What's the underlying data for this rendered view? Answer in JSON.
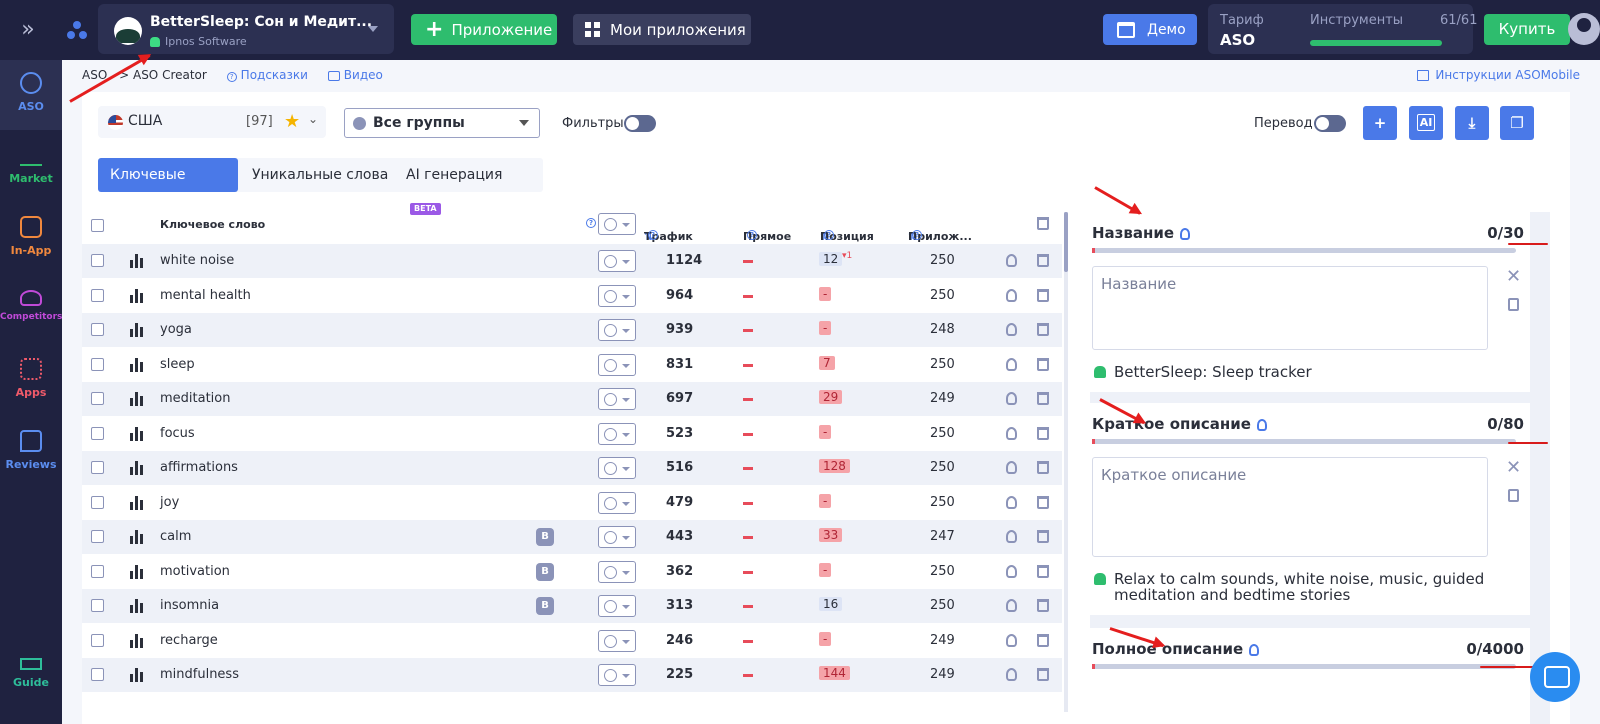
{
  "topbar": {
    "app_name": "BetterSleep: Сон и Медит...",
    "developer": "Ipnos Software",
    "add_app": "Приложение",
    "my_apps": "Мои приложения",
    "demo": "Демо",
    "tariff_label": "Тариф",
    "tariff_value": "ASO",
    "tools_label": "Инструменты",
    "tools_count": "61/61",
    "tools_usage": 1.0,
    "buy": "Купить"
  },
  "sidebar": {
    "items": [
      {
        "label": "ASO",
        "color": "#5b8def"
      },
      {
        "label": "Market",
        "color": "#2ebd6e"
      },
      {
        "label": "In-App",
        "color": "#f0883e"
      },
      {
        "label": "Competitors",
        "color": "#c04ad8"
      },
      {
        "label": "Apps",
        "color": "#ef5a6a"
      },
      {
        "label": "Reviews",
        "color": "#5b8def"
      },
      {
        "label": "Guide",
        "color": "#2ebd9a"
      }
    ]
  },
  "breadcrumb": {
    "root": "ASO",
    "current": "> ASO Creator",
    "hints": "Подсказки",
    "video": "Видео",
    "instructions": "Инструкции ASOMobile"
  },
  "controls": {
    "country": "США",
    "country_count": "[97]",
    "groups": "Все группы",
    "filters": "Фильтры",
    "translate": "Перевод",
    "ai_button": "AI"
  },
  "tabs": [
    {
      "label": "Ключевые слова"
    },
    {
      "label": "Уникальные слова"
    },
    {
      "label": "AI генерация",
      "badge": "BETA"
    }
  ],
  "table": {
    "headers": {
      "keyword": "Ключевое слово",
      "traffic": "Трафик",
      "direct": "Прямое ...",
      "position": "Позиция",
      "apps": "Прилож..."
    },
    "rows": [
      {
        "keyword": "white noise",
        "traffic": "1124",
        "position": "12",
        "pos_style": "blue",
        "change": "▾1",
        "apps": "250",
        "badge": ""
      },
      {
        "keyword": "mental health",
        "traffic": "964",
        "position": "-",
        "pos_style": "red",
        "change": "",
        "apps": "250",
        "badge": ""
      },
      {
        "keyword": "yoga",
        "traffic": "939",
        "position": "-",
        "pos_style": "red",
        "change": "",
        "apps": "248",
        "badge": ""
      },
      {
        "keyword": "sleep",
        "traffic": "831",
        "position": "7",
        "pos_style": "red",
        "change": "",
        "apps": "250",
        "badge": ""
      },
      {
        "keyword": "meditation",
        "traffic": "697",
        "position": "29",
        "pos_style": "red",
        "change": "",
        "apps": "249",
        "badge": ""
      },
      {
        "keyword": "focus",
        "traffic": "523",
        "position": "-",
        "pos_style": "red",
        "change": "",
        "apps": "250",
        "badge": ""
      },
      {
        "keyword": "affirmations",
        "traffic": "516",
        "position": "128",
        "pos_style": "red",
        "change": "",
        "apps": "250",
        "badge": ""
      },
      {
        "keyword": "joy",
        "traffic": "479",
        "position": "-",
        "pos_style": "red",
        "change": "",
        "apps": "250",
        "badge": ""
      },
      {
        "keyword": "calm",
        "traffic": "443",
        "position": "33",
        "pos_style": "red",
        "change": "",
        "apps": "247",
        "badge": "B"
      },
      {
        "keyword": "motivation",
        "traffic": "362",
        "position": "-",
        "pos_style": "red",
        "change": "",
        "apps": "250",
        "badge": "B"
      },
      {
        "keyword": "insomnia",
        "traffic": "313",
        "position": "16",
        "pos_style": "blue",
        "change": "",
        "apps": "250",
        "badge": "B"
      },
      {
        "keyword": "recharge",
        "traffic": "246",
        "position": "-",
        "pos_style": "red",
        "change": "",
        "apps": "249",
        "badge": ""
      },
      {
        "keyword": "mindfulness",
        "traffic": "225",
        "position": "144",
        "pos_style": "red",
        "change": "",
        "apps": "249",
        "badge": ""
      }
    ]
  },
  "editor": {
    "title": {
      "label": "Название",
      "count": "0/30",
      "placeholder": "Название",
      "current": "BetterSleep: Sleep tracker"
    },
    "short": {
      "label": "Краткое описание",
      "count": "0/80",
      "placeholder": "Краткое описание",
      "current": "Relax to calm sounds, white noise, music, guided meditation and bedtime stories"
    },
    "full": {
      "label": "Полное описание",
      "count": "0/4000"
    }
  }
}
